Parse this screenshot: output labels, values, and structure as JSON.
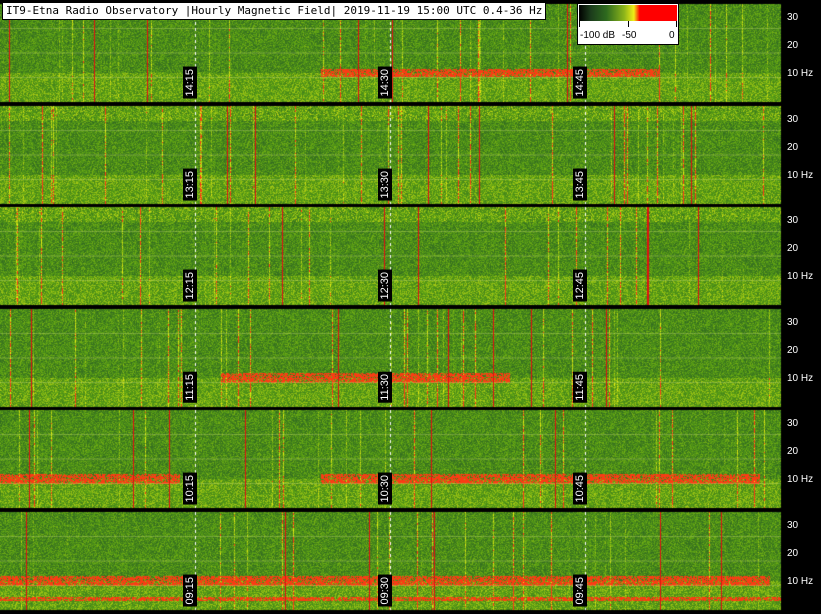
{
  "title": "IT9-Etna Radio Observatory |Hourly Magnetic Field| 2019-11-19 15:00 UTC 0.4-36 Hz",
  "colorbar": {
    "labels": [
      "-100 dB",
      "-50",
      "0"
    ],
    "range_db": [
      -100,
      0
    ]
  },
  "colors": {
    "background": "#000000",
    "low": "#1c3c1c",
    "mid": "#8cb41a",
    "high_yellow": "#f0ee16",
    "peak_red": "#ff0000"
  },
  "chart_data": {
    "type": "heatmap",
    "title": "IT9-Etna Radio Observatory |Hourly Magnetic Field| 2019-11-19 15:00 UTC 0.4-36 Hz",
    "ylabel_unit": "Hz",
    "ylim": [
      0.4,
      36
    ],
    "yticks": [
      "30",
      "20",
      "10 Hz"
    ],
    "rows": [
      {
        "hour": "14",
        "time_labels": [
          "14:15",
          "14:30",
          "14:45"
        ]
      },
      {
        "hour": "13",
        "time_labels": [
          "13:15",
          "13:30",
          "13:45"
        ]
      },
      {
        "hour": "12",
        "time_labels": [
          "12:15",
          "12:30",
          "12:45"
        ]
      },
      {
        "hour": "11",
        "time_labels": [
          "11:15",
          "11:30",
          "11:45"
        ]
      },
      {
        "hour": "10",
        "time_labels": [
          "10:15",
          "10:30",
          "10:45"
        ]
      },
      {
        "hour": "09",
        "time_labels": [
          "09:15",
          "09:30",
          "09:45"
        ]
      }
    ]
  }
}
